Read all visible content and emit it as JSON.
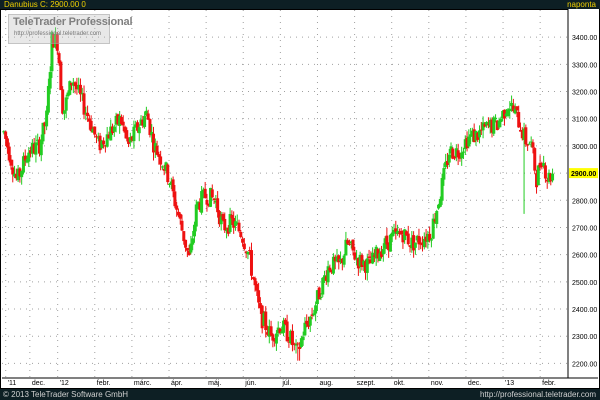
{
  "header": {
    "title": "Danubius C: 2900.00 0",
    "period": "naponta"
  },
  "watermark": {
    "brand": "TeleTrader Professional",
    "url": "http://professional.teletrader.com"
  },
  "footer": {
    "copyright": "© 2013 TeleTrader Software GmbH",
    "site": "http://professional.teletrader.com"
  },
  "colors": {
    "up": "#22cc22",
    "down": "#ee1111",
    "grid": "#a0a0a0",
    "axis_bg": "#ffffff",
    "last_price_bg": "#ffff00",
    "top_bar_bg": "#0d1f24",
    "top_bar_text": "#f0d000"
  },
  "chart_data": {
    "type": "candlestick",
    "title": "Danubius C: 2900.00 0",
    "period": "naponta",
    "y_axis_position": "right",
    "ylim": [
      2150,
      3500
    ],
    "y_ticks": [
      2200,
      2300,
      2400,
      2500,
      2600,
      2700,
      2800,
      2900,
      3000,
      3100,
      3200,
      3300,
      3400
    ],
    "y_tick_labels": [
      "2200.00",
      "2300.00",
      "2400.00",
      "2500.00",
      "2600.00",
      "2700.00",
      "2800.00",
      "2900.00",
      "3000.00",
      "3100.00",
      "3200.00",
      "3300.00",
      "3400.00"
    ],
    "last_price": 2900,
    "last_price_label": "2900.00",
    "x_tick_labels": [
      "'11",
      "dec.",
      "'12",
      "febr.",
      "márc.",
      "ápr.",
      "máj.",
      "jún.",
      "júl.",
      "aug.",
      "szept.",
      "okt.",
      "nov.",
      "dec.",
      "'13",
      "febr."
    ],
    "x_tick_months": [
      -0.4,
      0.25,
      1,
      2,
      3,
      4,
      5,
      6,
      7,
      8,
      9,
      10,
      11,
      12,
      13,
      14
    ],
    "x_range_months": [
      -0.5,
      14.75
    ],
    "grid": true,
    "price_path": [
      [
        -0.45,
        3050
      ],
      [
        -0.1,
        2870
      ],
      [
        0.2,
        2980
      ],
      [
        0.5,
        3000
      ],
      [
        0.7,
        3100
      ],
      [
        0.85,
        3400
      ],
      [
        1.0,
        3380
      ],
      [
        1.15,
        3120
      ],
      [
        1.4,
        3250
      ],
      [
        1.6,
        3180
      ],
      [
        1.85,
        3100
      ],
      [
        2.1,
        3000
      ],
      [
        2.4,
        3050
      ],
      [
        2.7,
        3100
      ],
      [
        2.9,
        3000
      ],
      [
        3.2,
        3080
      ],
      [
        3.4,
        3120
      ],
      [
        3.6,
        3000
      ],
      [
        3.8,
        2950
      ],
      [
        4.0,
        2880
      ],
      [
        4.3,
        2720
      ],
      [
        4.55,
        2580
      ],
      [
        4.75,
        2780
      ],
      [
        5.0,
        2820
      ],
      [
        5.25,
        2800
      ],
      [
        5.45,
        2700
      ],
      [
        5.7,
        2720
      ],
      [
        5.95,
        2680
      ],
      [
        6.15,
        2600
      ],
      [
        6.45,
        2380
      ],
      [
        6.75,
        2300
      ],
      [
        7.0,
        2340
      ],
      [
        7.25,
        2300
      ],
      [
        7.45,
        2230
      ],
      [
        7.65,
        2330
      ],
      [
        7.85,
        2380
      ],
      [
        8.05,
        2460
      ],
      [
        8.3,
        2560
      ],
      [
        8.6,
        2560
      ],
      [
        8.8,
        2640
      ],
      [
        9.1,
        2580
      ],
      [
        9.4,
        2560
      ],
      [
        9.7,
        2620
      ],
      [
        10.0,
        2660
      ],
      [
        10.3,
        2680
      ],
      [
        10.55,
        2640
      ],
      [
        10.8,
        2660
      ],
      [
        11.05,
        2680
      ],
      [
        11.3,
        2820
      ],
      [
        11.55,
        2980
      ],
      [
        11.8,
        2980
      ],
      [
        12.05,
        3030
      ],
      [
        12.3,
        3040
      ],
      [
        12.6,
        3070
      ],
      [
        12.85,
        3080
      ],
      [
        13.15,
        3160
      ],
      [
        13.4,
        3100
      ],
      [
        13.6,
        3020
      ],
      [
        13.75,
        3010
      ],
      [
        13.9,
        2880
      ],
      [
        14.05,
        2960
      ],
      [
        14.2,
        2880
      ],
      [
        14.35,
        2900
      ]
    ],
    "annotations": [
      "low spike ~2750 near mid-Jan '13",
      "low spike ~2210 near late Jul '12"
    ]
  }
}
